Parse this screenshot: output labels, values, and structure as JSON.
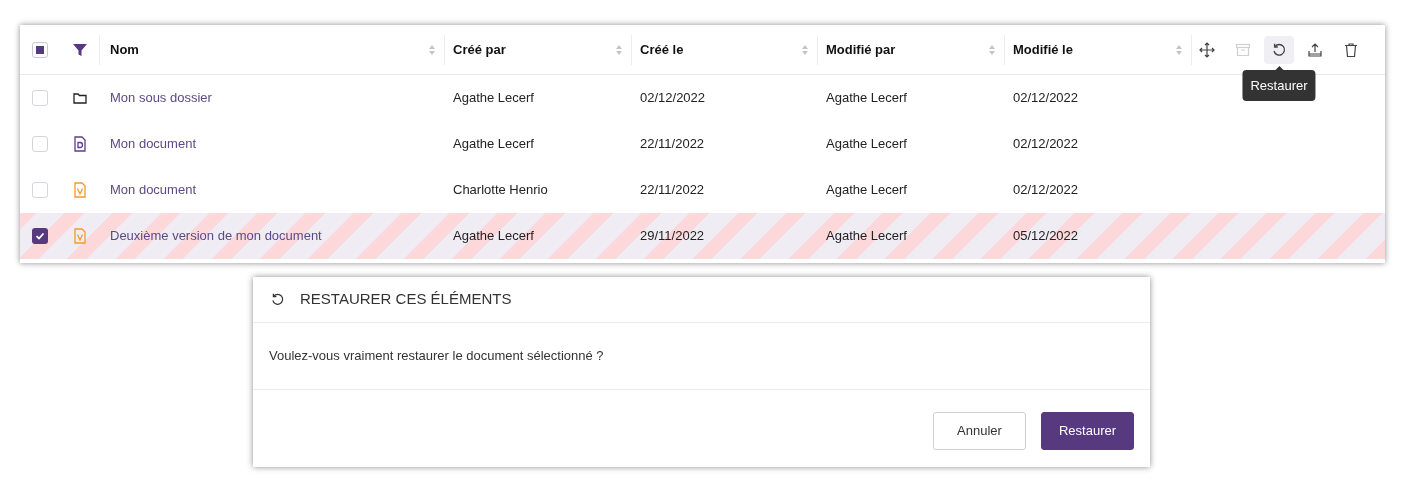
{
  "table": {
    "select_all": {
      "indeterminate": true
    },
    "columns": [
      "Nom",
      "Créé par",
      "Créé le",
      "Modifié par",
      "Modifié le"
    ],
    "actions": [
      {
        "kind": "move",
        "disabled": false,
        "hovered": false
      },
      {
        "kind": "archive",
        "disabled": true,
        "hovered": false
      },
      {
        "kind": "restore",
        "disabled": false,
        "hovered": true,
        "tooltip": "Restaurer"
      },
      {
        "kind": "upload",
        "disabled": false,
        "hovered": false
      },
      {
        "kind": "delete",
        "disabled": false,
        "hovered": false
      }
    ],
    "rows": [
      {
        "kind": "folder",
        "selected": false,
        "cells": [
          "Mon sous dossier",
          "Agathe Lecerf",
          "02/12/2022",
          "Agathe Lecerf",
          "02/12/2022"
        ]
      },
      {
        "kind": "document",
        "selected": false,
        "cells": [
          "Mon document",
          "Agathe Lecerf",
          "22/11/2022",
          "Agathe Lecerf",
          "02/12/2022"
        ]
      },
      {
        "kind": "version",
        "selected": false,
        "cells": [
          "Mon document",
          "Charlotte Henrio",
          "22/11/2022",
          "Agathe Lecerf",
          "02/12/2022"
        ]
      },
      {
        "kind": "version",
        "selected": true,
        "cells": [
          "Deuxième version de mon document",
          "Agathe Lecerf",
          "29/11/2022",
          "Agathe Lecerf",
          "05/12/2022"
        ]
      }
    ]
  },
  "dialog": {
    "title": "RESTAURER CES ÉLÉMENTS",
    "message": "Voulez-vous vraiment restaurer le document sélectionné ?",
    "buttons": [
      {
        "label": "Annuler",
        "kind": "secondary"
      },
      {
        "label": "Restaurer",
        "kind": "primary"
      }
    ]
  }
}
